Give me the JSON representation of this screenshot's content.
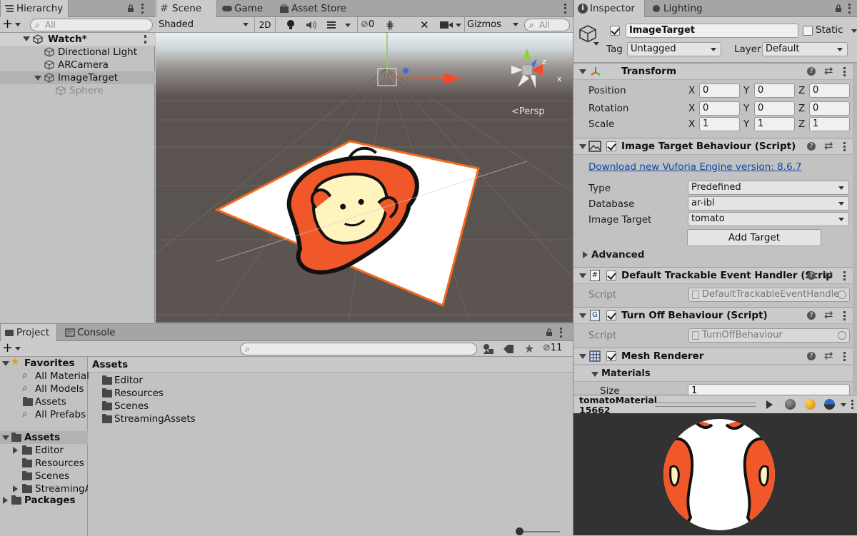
{
  "hierarchy": {
    "tab": "Hierarchy",
    "search_placeholder": "All",
    "scene_name": "Watch*",
    "items": [
      {
        "label": "Directional Light"
      },
      {
        "label": "ARCamera"
      },
      {
        "label": "ImageTarget"
      },
      {
        "label": "Sphere"
      }
    ]
  },
  "scene_view": {
    "tabs": [
      "Scene",
      "Game",
      "Asset Store"
    ],
    "shading_mode": "Shaded",
    "btn_2d": "2D",
    "hidden_count": "0",
    "gizmos": "Gizmos",
    "search_placeholder": "All",
    "persp_label": "Persp",
    "axis_x": "x",
    "axis_z": "z"
  },
  "project": {
    "tabs": [
      "Project",
      "Console"
    ],
    "favorites_label": "Favorites",
    "favorites": [
      "All Materials",
      "All Models",
      "Assets",
      "All Prefabs"
    ],
    "assets_root": "Assets",
    "asset_folders": [
      "Editor",
      "Resources",
      "Scenes",
      "StreamingA"
    ],
    "packages": "Packages",
    "breadcrumb": "Assets",
    "grid_items": [
      "Editor",
      "Resources",
      "Scenes",
      "StreamingAssets"
    ],
    "hidden_count": "11",
    "zoom_fraction": 0.05
  },
  "inspector": {
    "tabs": [
      "Inspector",
      "Lighting"
    ],
    "object_name": "ImageTarget",
    "static_label": "Static",
    "tag_label": "Tag",
    "tag_value": "Untagged",
    "layer_label": "Layer",
    "layer_value": "Default",
    "transform": {
      "title": "Transform",
      "rows": [
        {
          "label": "Position",
          "x": "0",
          "y": "0",
          "z": "0"
        },
        {
          "label": "Rotation",
          "x": "0",
          "y": "0",
          "z": "0"
        },
        {
          "label": "Scale",
          "x": "1",
          "y": "1",
          "z": "1"
        }
      ],
      "axis_x": "X",
      "axis_y": "Y",
      "axis_z": "Z"
    },
    "image_target": {
      "title": "Image Target Behaviour (Script)",
      "download_link": "Download new Vuforia Engine version: 8.6.7",
      "type_label": "Type",
      "type_value": "Predefined",
      "database_label": "Database",
      "database_value": "ar-ibl",
      "target_label": "Image Target",
      "target_value": "tomato",
      "add_target": "Add Target",
      "advanced": "Advanced"
    },
    "trackable": {
      "title": "Default Trackable Event Handler (Scrip",
      "script_label": "Script",
      "script_value": "DefaultTrackableEventHandle"
    },
    "turnoff": {
      "title": "Turn Off Behaviour (Script)",
      "script_label": "Script",
      "script_value": "TurnOffBehaviour"
    },
    "mesh_renderer": {
      "title": "Mesh Renderer",
      "materials": "Materials",
      "size_label": "Size",
      "size_value": "1"
    },
    "preview": {
      "name_line1": "tomatoMaterial",
      "name_line2": "15662"
    }
  },
  "colors": {
    "accent_orange": "#f26b1d",
    "selection_grey": "#b2b2b2",
    "link_blue": "#0b4aa8",
    "scene_bg": "#5a5350"
  }
}
